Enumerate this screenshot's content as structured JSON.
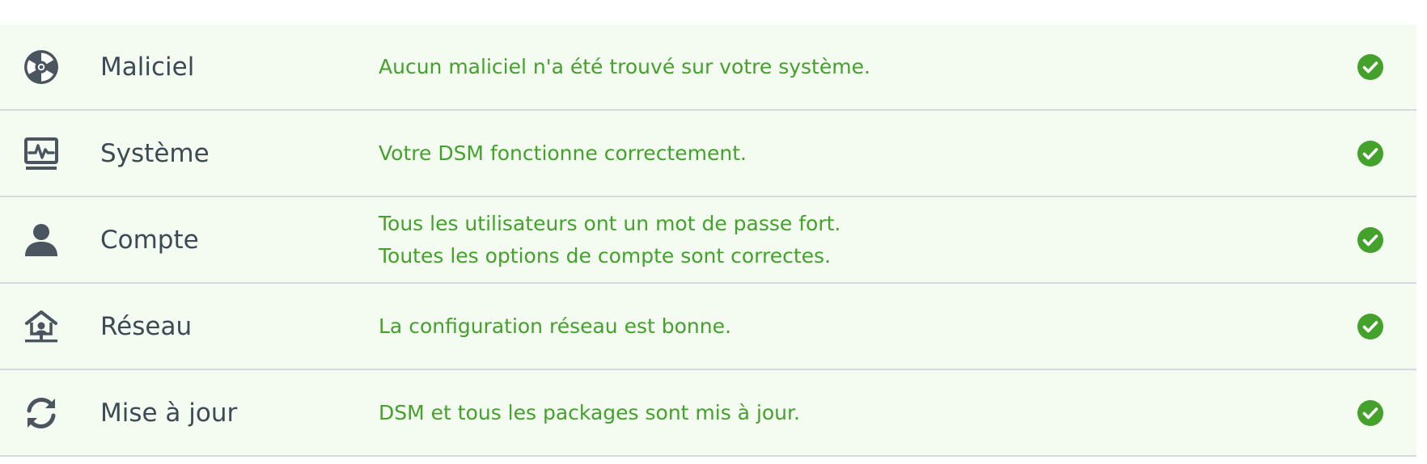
{
  "colors": {
    "row_background": "#f4fcf1",
    "divider": "#d3dbe1",
    "label_text": "#3d4a55",
    "message_text": "#43a12c",
    "status_ok": "#43a12c",
    "icon": "#4a555f"
  },
  "rows": [
    {
      "icon": "radiation-icon",
      "label": "Maliciel",
      "messages": [
        "Aucun maliciel n'a été trouvé sur votre système."
      ],
      "status": "ok"
    },
    {
      "icon": "system-monitor-icon",
      "label": "Système",
      "messages": [
        "Votre DSM fonctionne correctement."
      ],
      "status": "ok"
    },
    {
      "icon": "user-icon",
      "label": "Compte",
      "messages": [
        "Tous les utilisateurs ont un mot de passe fort.",
        "Toutes les options de compte sont correctes."
      ],
      "status": "ok"
    },
    {
      "icon": "network-home-icon",
      "label": "Réseau",
      "messages": [
        "La configuration réseau est bonne."
      ],
      "status": "ok"
    },
    {
      "icon": "refresh-icon",
      "label": "Mise à jour",
      "messages": [
        "DSM et tous les packages sont mis à jour."
      ],
      "status": "ok"
    }
  ]
}
